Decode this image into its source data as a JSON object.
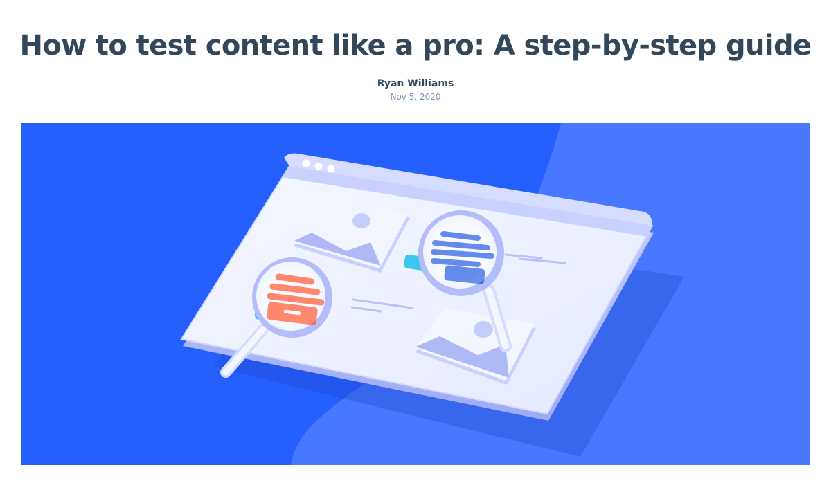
{
  "article": {
    "title": "How to test content like a pro: A step-by-step guide",
    "author": "Ryan Williams",
    "date": "Nov 5, 2020"
  },
  "hero": {
    "illustration": "browser-window-with-magnifying-glasses",
    "colors": {
      "background": "#2560ff",
      "background_light": "#4778ff",
      "window": "#eef1ff",
      "window_border": "#c4ccff",
      "accent_orange": "#ff6b4a",
      "accent_blue": "#3f6fe8",
      "accent_teal": "#3dc6f0"
    }
  }
}
